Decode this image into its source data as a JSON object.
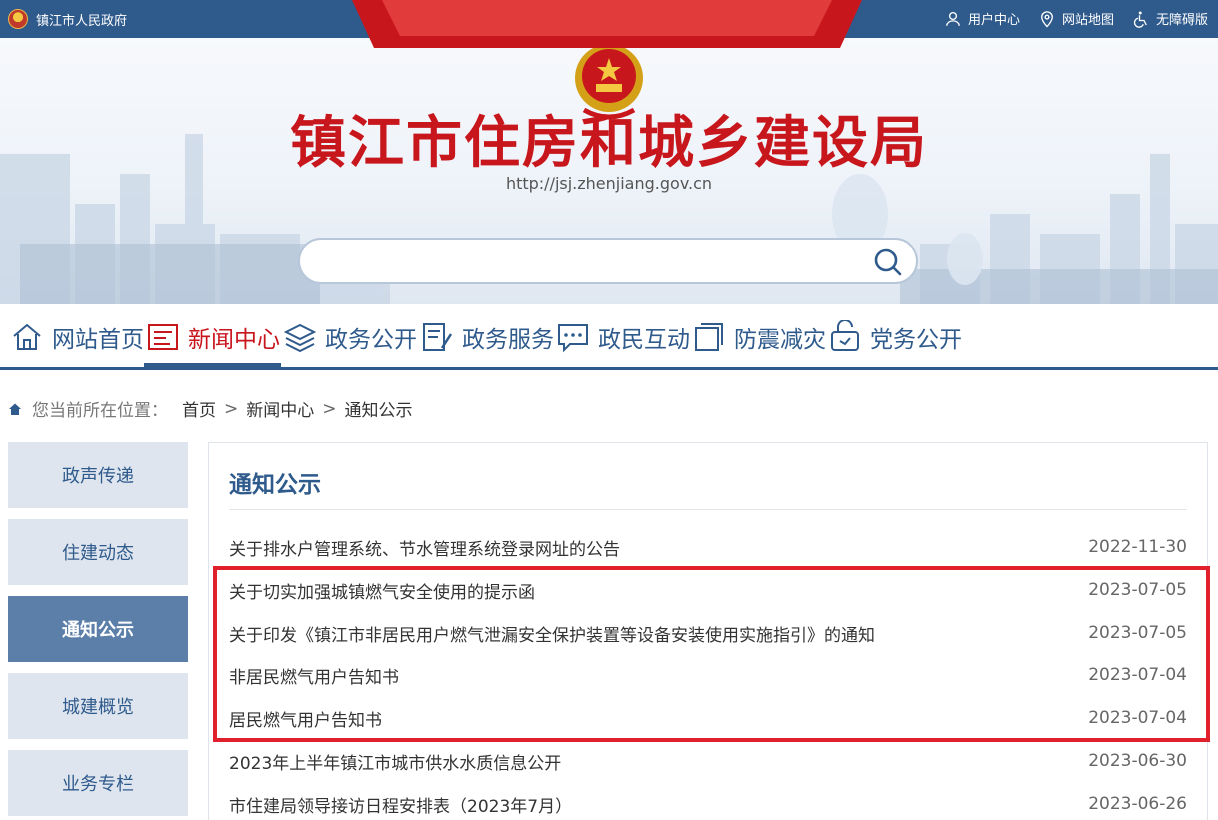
{
  "topbar": {
    "gov_name": "镇江市人民政府",
    "links": [
      {
        "label": "用户中心",
        "icon": "user-icon"
      },
      {
        "label": "网站地图",
        "icon": "location-pin-icon"
      },
      {
        "label": "无障碍版",
        "icon": "accessibility-icon"
      }
    ]
  },
  "banner": {
    "title": "镇江市住房和城乡建设局",
    "url": "http://jsj.zhenjiang.gov.cn",
    "search": {
      "value": "",
      "placeholder": ""
    }
  },
  "nav": {
    "items": [
      {
        "label": "网站首页",
        "icon": "home-icon"
      },
      {
        "label": "新闻中心",
        "icon": "news-icon",
        "active": true
      },
      {
        "label": "政务公开",
        "icon": "layers-icon"
      },
      {
        "label": "政务服务",
        "icon": "document-pen-icon"
      },
      {
        "label": "政民互动",
        "icon": "chat-icon"
      },
      {
        "label": "防震减灾",
        "icon": "square-stack-icon"
      },
      {
        "label": "党务公开",
        "icon": "party-icon"
      }
    ]
  },
  "breadcrumb": {
    "prefix": "您当前所在位置：",
    "items": [
      "首页",
      "新闻中心",
      "通知公示"
    ],
    "separator": ">"
  },
  "sidebar": {
    "items": [
      {
        "label": "政声传递"
      },
      {
        "label": "住建动态"
      },
      {
        "label": "通知公示",
        "active": true
      },
      {
        "label": "城建概览"
      },
      {
        "label": "业务专栏"
      }
    ]
  },
  "main": {
    "title": "通知公示",
    "list": [
      {
        "title": "关于排水户管理系统、节水管理系统登录网址的公告",
        "date": "2022-11-30"
      },
      {
        "title": "关于切实加强城镇燃气安全使用的提示函",
        "date": "2023-07-05"
      },
      {
        "title": "关于印发《镇江市非居民用户燃气泄漏安全保护装置等设备安装使用实施指引》的通知",
        "date": "2023-07-05"
      },
      {
        "title": "非居民燃气用户告知书",
        "date": "2023-07-04"
      },
      {
        "title": "居民燃气用户告知书",
        "date": "2023-07-04"
      },
      {
        "title": "2023年上半年镇江市城市供水水质信息公开",
        "date": "2023-06-30"
      },
      {
        "title": "市住建局领导接访日程安排表（2023年7月）",
        "date": "2023-06-26"
      }
    ]
  },
  "colors": {
    "brand_blue": "#2f5a8c",
    "title_red": "#c8161d",
    "highlight_red": "#e0202b",
    "sidebar_bg": "#dee5ee",
    "sidebar_active": "#5c7fa9"
  }
}
